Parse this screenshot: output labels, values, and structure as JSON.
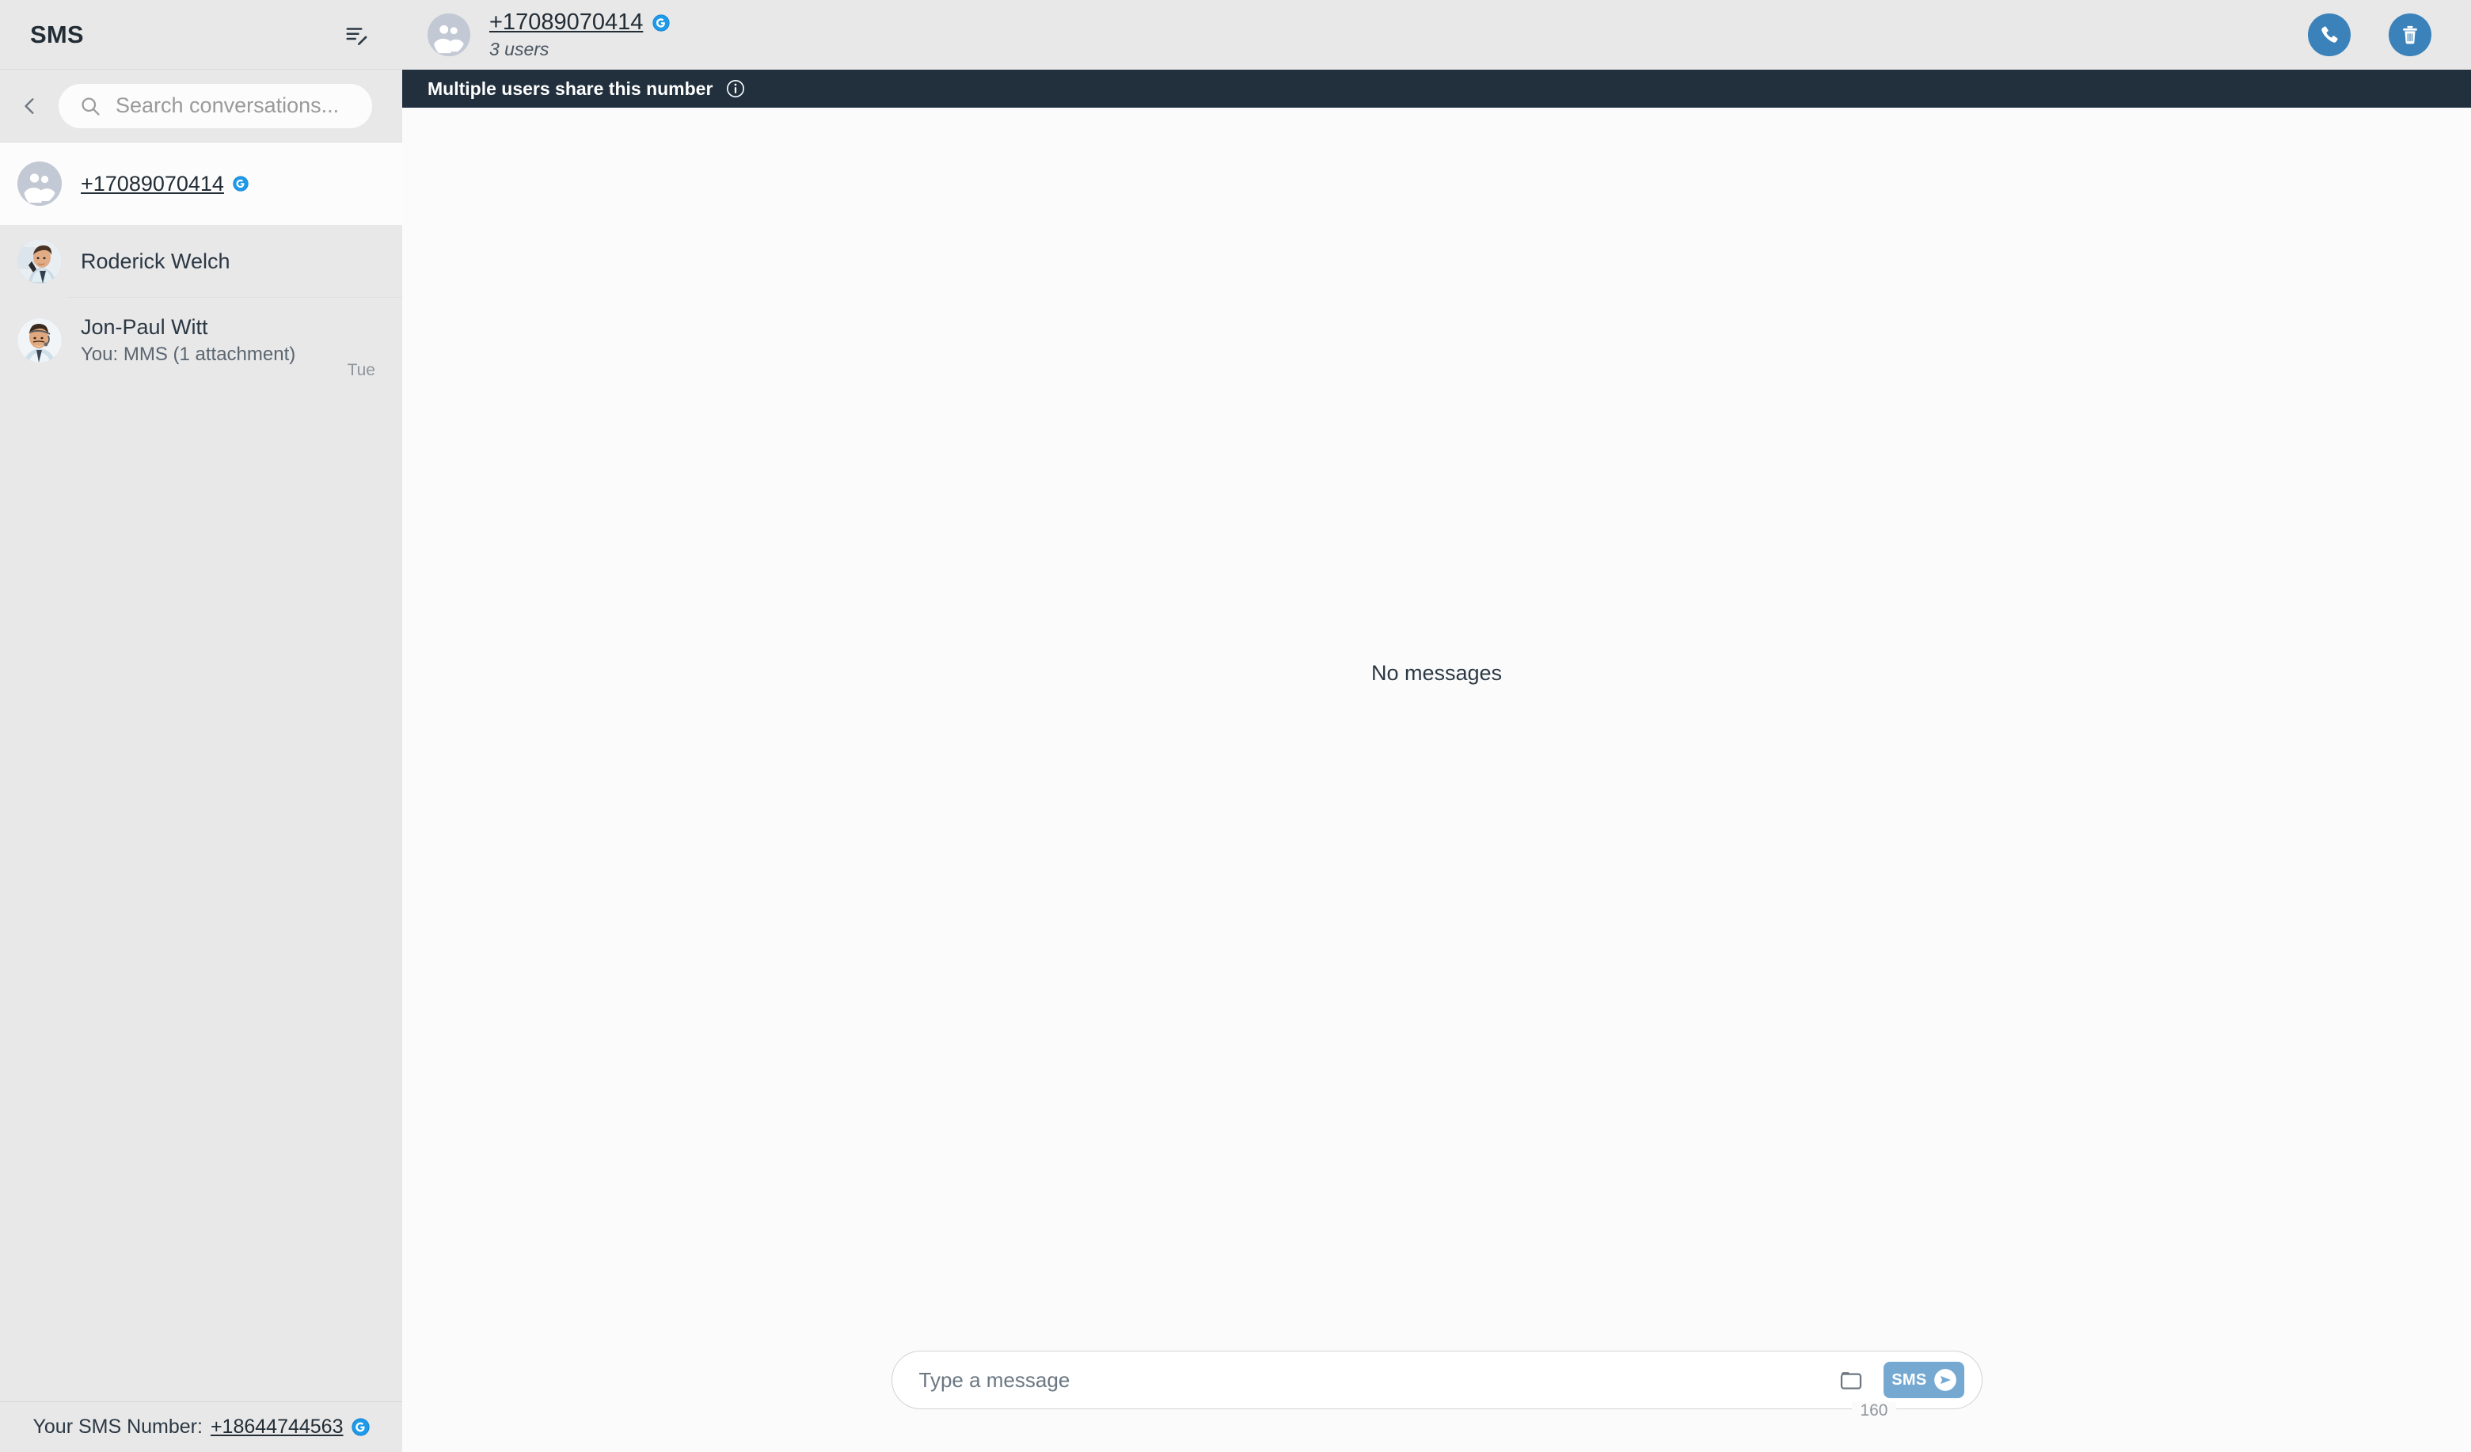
{
  "sidebar": {
    "title": "SMS",
    "compose_icon": "compose-icon",
    "back_icon": "chevron-left-icon",
    "search": {
      "placeholder": "Search conversations...",
      "value": "",
      "icon": "search-icon"
    },
    "conversations": [
      {
        "name": "+17089070414",
        "preview": "",
        "time": "",
        "avatar_type": "group",
        "badge": "g-badge-icon",
        "is_link": true,
        "active": true
      },
      {
        "name": "Roderick Welch",
        "preview": "",
        "time": "",
        "avatar_type": "photo-man-phone",
        "badge": "",
        "is_link": false,
        "active": false
      },
      {
        "name": "Jon-Paul Witt",
        "preview": "You: MMS (1 attachment)",
        "time": "Tue",
        "avatar_type": "photo-man-headset",
        "badge": "",
        "is_link": false,
        "active": false
      }
    ],
    "footer": {
      "label": "Your SMS Number:",
      "number": "+18644744563",
      "badge": "g-badge-icon"
    }
  },
  "main": {
    "header": {
      "avatar_type": "group",
      "number": "+17089070414",
      "badge": "g-badge-icon",
      "subtitle": "3 users",
      "call_button": "call-button",
      "delete_button": "delete-button"
    },
    "notice": {
      "text": "Multiple users share this number",
      "icon": "info-icon"
    },
    "empty_state": "No messages",
    "composer": {
      "placeholder": "Type a message",
      "value": "",
      "attach_icon": "attachment-folder-icon",
      "send_label": "SMS",
      "send_icon": "send-arrow-icon",
      "char_counter": "160"
    }
  },
  "colors": {
    "sidebar_bg": "#e8e8e8",
    "main_bg": "#fbfbfb",
    "notice_bg": "#22303e",
    "accent_blue": "#3b82ba",
    "send_blue": "#76a9d1",
    "badge_blue": "#2196f3",
    "text_dark": "#222d36"
  }
}
